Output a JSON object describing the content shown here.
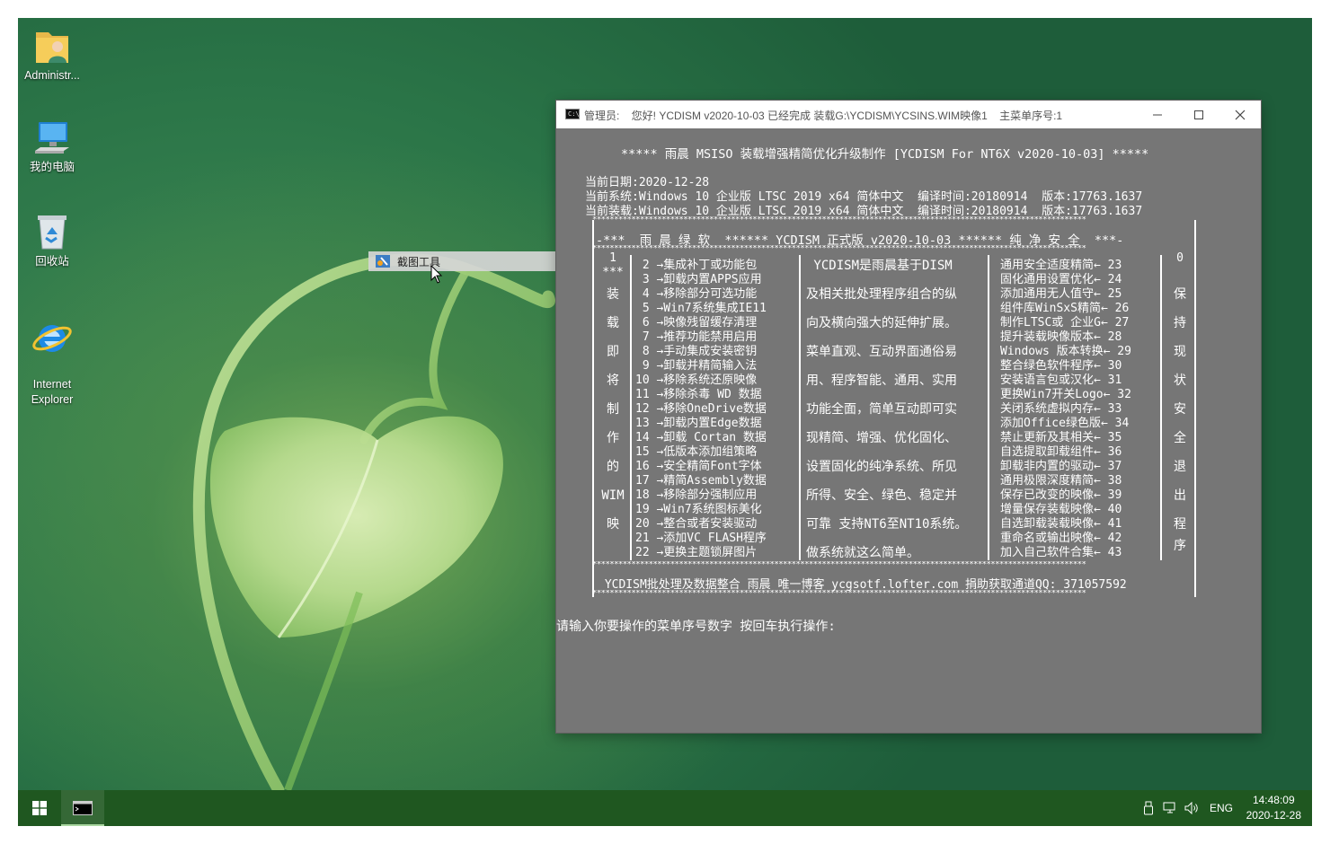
{
  "desktop": {
    "icons": [
      {
        "label": "Administr..."
      },
      {
        "label": "我的电脑"
      },
      {
        "label": "回收站"
      },
      {
        "label": "Internet\nExplorer"
      }
    ],
    "snip_popup": {
      "label": "截图工具"
    }
  },
  "console": {
    "title": "管理员:    您好! YCDISM v2020-10-03 已经完成 装载G:\\YCDISM\\YCSINS.WIM映像1    主菜单序号:1",
    "header": "***** 雨晨 MSISO 装载增强精简优化升级制作 [YCDISM For NT6X v2020-10-03] *****",
    "info": [
      "当前日期:2020-12-28",
      "当前系统:Windows 10 企业版 LTSC 2019 x64 简体中文  编译时间:20180914  版本:17763.1637",
      "当前装载:Windows 10 企业版 LTSC 2019 x64 简体中文  编译时间:20180914  版本:17763.1637"
    ],
    "stars": "******************************************************************************************************************",
    "banner": "-***  雨 晨 绿 软  ****** YCDISM 正式版 v2020-10-03 ****** 纯 净 安 全  ***-",
    "col1": [
      "1",
      "***",
      "装",
      "载",
      "即",
      "将",
      "制",
      "作",
      "的",
      "WIM",
      "映"
    ],
    "col2": [
      " 2 →集成补丁或功能包",
      " 3 →卸载内置APPS应用",
      " 4 →移除部分可选功能",
      " 5 →Win7系统集成IE11",
      " 6 →映像残留缓存清理",
      " 7 →推荐功能禁用启用",
      " 8 →手动集成安装密钥",
      " 9 →卸载并精简输入法",
      "10 →移除系统还原映像",
      "11 →移除杀毒 WD 数据",
      "12 →移除OneDrive数据",
      "13 →卸载内置Edge数据",
      "14 →卸载 Cortan 数据",
      "15 →低版本添加组策略",
      "16 →安全精简Font字体",
      "17 →精简Assembly数据",
      "18 →移除部分强制应用",
      "19 →Win7系统图标美化",
      "20 →整合或者安装驱动",
      "21 →添加VC FLASH程序",
      "22 →更换主题锁屏图片"
    ],
    "col3": [
      " YCDISM是雨晨基于DISM",
      "及相关批处理程序组合的纵",
      "向及横向强大的延伸扩展。",
      "菜单直观、互动界面通俗易",
      "用、程序智能、通用、实用",
      "功能全面，简单互动即可实",
      "现精简、增强、优化固化、",
      "设置固化的纯净系统、所见",
      "所得、安全、绿色、稳定并",
      "可靠 支持NT6至NT10系统。",
      "做系统就这么简单。"
    ],
    "col4": [
      "通用安全适度精简← 23",
      "固化通用设置优化← 24",
      "添加通用无人值守← 25",
      "组件库WinSxS精简← 26",
      "制作LTSC或 企业G← 27",
      "提升装载映像版本← 28",
      "Windows 版本转换← 29",
      "整合绿色软件程序← 30",
      "安装语言包或汉化← 31",
      "更换Win7开关Logo← 32",
      "关闭系统虚拟内存← 33",
      "添加Office绿色版← 34",
      "禁止更新及其相关← 35",
      "自选提取卸载组件← 36",
      "卸载非内置的驱动← 37",
      "通用极限深度精简← 38",
      "保存已改变的映像← 39",
      "增量保存装载映像← 40",
      "自选卸载装载映像← 41",
      "重命名或输出映像← 42",
      "加入自己软件合集← 43"
    ],
    "col5": [
      "0",
      "保",
      "持",
      "现",
      "状",
      "安",
      "全",
      "退",
      "出",
      "程",
      "序"
    ],
    "footer": " YCDISM批处理及数据整合 雨晨 唯一博客 ycgsotf.lofter.com 捐助获取通道QQ: 371057592",
    "prompt": "请输入你要操作的菜单序号数字 按回车执行操作:"
  },
  "taskbar": {
    "language": "ENG",
    "time": "14:48:09",
    "date": "2020-12-28"
  }
}
